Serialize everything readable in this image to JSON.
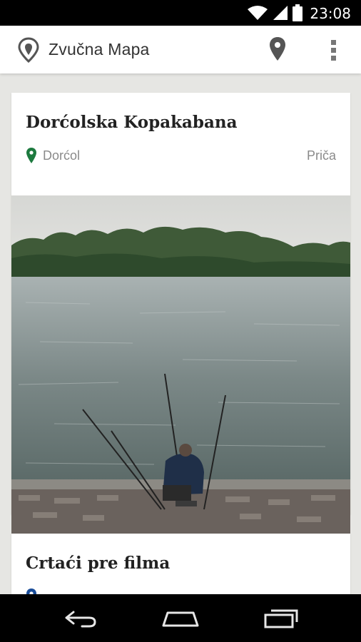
{
  "status_bar": {
    "time": "23:08",
    "icons": [
      "wifi-icon",
      "signal-icon",
      "battery-icon"
    ]
  },
  "app_bar": {
    "title": "Zvučna Mapa",
    "logo_icon": "pin-outline-icon",
    "actions": [
      "map-pin-icon",
      "more-vert-icon"
    ]
  },
  "cards": [
    {
      "title": "Dorćolska Kopakabana",
      "location": "Dorćol",
      "type": "Priča",
      "pin_color": "#1d7a3f",
      "image": "photo: man fishing by the river with tree line in background"
    },
    {
      "title": "Crtaći pre filma",
      "location": "",
      "type": "",
      "pin_color": "#1a4d99"
    }
  ],
  "nav_bar": {
    "buttons": [
      "back-icon",
      "home-icon",
      "recent-apps-icon"
    ]
  },
  "colors": {
    "background": "#e6e6e3",
    "card": "#ffffff",
    "app_bar": "#ffffff",
    "system_bar": "#000000"
  }
}
